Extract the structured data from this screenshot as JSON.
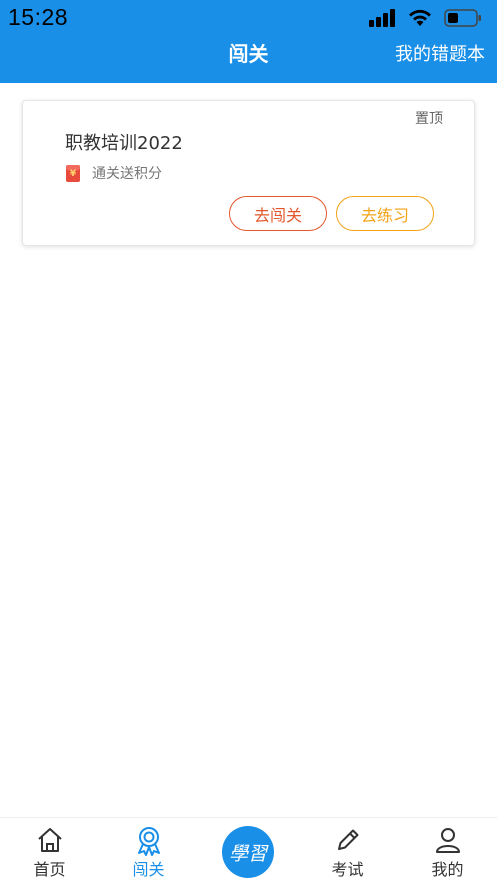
{
  "status_bar": {
    "time": "15:28"
  },
  "nav": {
    "title": "闯关",
    "action": "我的错题本"
  },
  "card": {
    "pin_label": "置顶",
    "title": "职教培训2022",
    "reward_icon_glyph": "¥",
    "reward_text": "通关送积分",
    "challenge_button": "去闯关",
    "practice_button": "去练习"
  },
  "tabbar": {
    "home": "首页",
    "challenge": "闯关",
    "center": "學習",
    "exam": "考试",
    "mine": "我的"
  },
  "colors": {
    "primary": "#1a8fe8",
    "challenge_btn": "#e2572b",
    "practice_btn": "#f2a31a",
    "reward_red": "#e84a3c"
  }
}
